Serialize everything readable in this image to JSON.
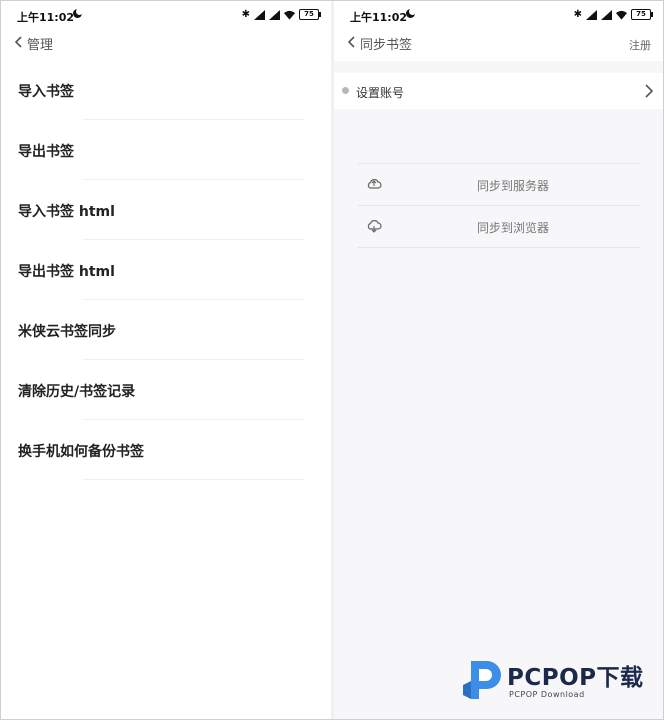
{
  "left": {
    "status": {
      "time": "上午11:02",
      "battery": "75"
    },
    "nav": {
      "title": "管理"
    },
    "items": [
      {
        "label": "导入书签"
      },
      {
        "label": "导出书签"
      },
      {
        "label": "导入书签 html"
      },
      {
        "label": "导出书签 html"
      },
      {
        "label": "米侠云书签同步"
      },
      {
        "label": "清除历史/书签记录"
      },
      {
        "label": "换手机如何备份书签"
      }
    ]
  },
  "right": {
    "status": {
      "time": "上午11:02",
      "battery": "75"
    },
    "nav": {
      "title": "同步书签",
      "action": "注册"
    },
    "account": {
      "label": "设置账号"
    },
    "sync": [
      {
        "label": "同步到服务器",
        "icon": "cloud-upload-icon"
      },
      {
        "label": "同步到浏览器",
        "icon": "cloud-download-icon"
      }
    ]
  },
  "watermark": {
    "brand": "PCPOP下载",
    "sub": "PCPOP Download"
  },
  "colors": {
    "accent": "#3d8ee6",
    "brand_text": "#1b2a4a",
    "divider": "#efefef"
  }
}
